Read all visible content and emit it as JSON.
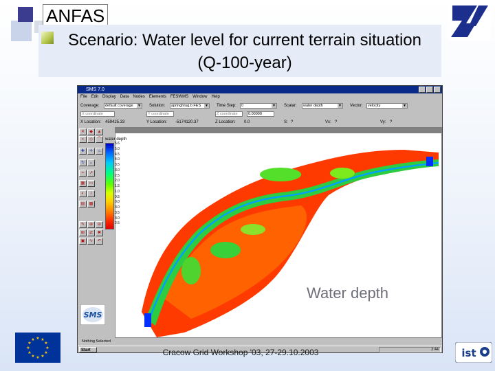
{
  "slide": {
    "title": "ANFAS",
    "subtitle": "Scenario:  Water level for current terrain situation (Q-100-year)",
    "overlay_label": "Water depth",
    "footer": "Cracow Grid Workshop '03, 27-29.10.2003"
  },
  "app": {
    "window_title": "SMS 7.0",
    "menu": [
      "File",
      "Edit",
      "Display",
      "Data",
      "Nodes",
      "Elements",
      "FESWMS",
      "Window",
      "Help"
    ],
    "row1": {
      "coverage_label": "Coverage:",
      "coverage_value": "default coverage",
      "solution_label": "Solution:",
      "solution_value": "apringhrug.b FES",
      "timestep_label": "Time Step:",
      "timestep_value": "0",
      "scalar_label": "Scalar:",
      "scalar_value": "water depth",
      "vector_label": "Vector:",
      "vector_value": "velocity"
    },
    "row2": {
      "x_coord_label": "X coordinate",
      "y_coord_label": "Y coordinate",
      "z_coord_label": "Z coordinate",
      "z_value": "0.00000"
    },
    "row3": {
      "x_loc_label": "X Location:",
      "x_loc_value": "459425.33",
      "y_loc_label": "Y Location:",
      "y_loc_value": "-5174120.37",
      "z_loc_label": "Z Location:",
      "z_loc_value": "0.0",
      "s_label": "S:",
      "s_value": "?",
      "vx_label": "Vx:",
      "vx_value": "?",
      "vy_label": "Vy:",
      "vy_value": "?"
    },
    "legend": {
      "title": "water depth",
      "labels": [
        "5.6",
        "5.0",
        "4.5",
        "4.0",
        "3.5",
        "3.0",
        "2.5",
        "2.0",
        "1.5",
        "1.0",
        "0.5",
        "0.0",
        "3.0",
        "3.5",
        "3.0",
        "2.5",
        "2.0",
        "1.5",
        "1.0",
        "0.5",
        "0.0"
      ]
    },
    "status": "Nothing Selected",
    "start": "Start",
    "clock": "2:44"
  },
  "colors": {
    "title_band": "#e6ecf7",
    "window_chrome": "#c0c0c0",
    "titlebar": "#0a2a8a",
    "water_shallow": "#ff3000",
    "water_deep": "#0000c8"
  },
  "icons": [
    "ist-logo-icon",
    "sms-logo-icon",
    "eu-flag-icon",
    "toolbox-icons"
  ]
}
